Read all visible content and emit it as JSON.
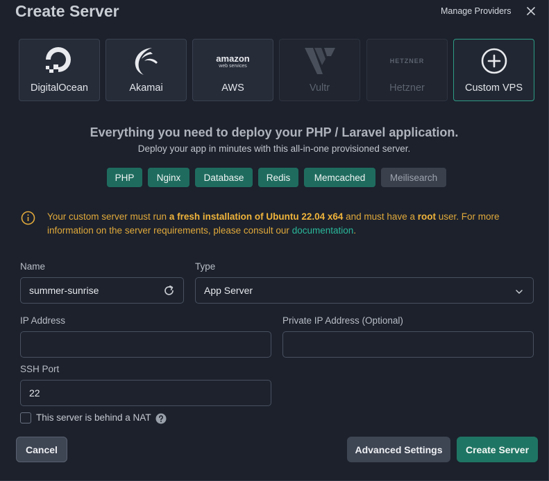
{
  "modal": {
    "title": "Create Server",
    "manage_providers": "Manage Providers",
    "close_icon": "close-icon"
  },
  "providers": [
    {
      "name": "DigitalOcean",
      "icon": "digitalocean-logo",
      "state": "normal"
    },
    {
      "name": "Akamai",
      "icon": "akamai-logo",
      "state": "normal"
    },
    {
      "name": "AWS",
      "icon": "aws-logo",
      "state": "normal",
      "logo_text": "amazon",
      "logo_subtext": "web services"
    },
    {
      "name": "Vultr",
      "icon": "vultr-logo",
      "state": "disabled"
    },
    {
      "name": "Hetzner",
      "icon": "hetzner-logo",
      "state": "disabled",
      "logo_text": "HETZNER"
    },
    {
      "name": "Custom VPS",
      "icon": "plus-circle-icon",
      "state": "selected"
    }
  ],
  "intro": {
    "headline": "Everything you need to deploy your PHP / Laravel application.",
    "subline": "Deploy your app in minutes with this all-in-one provisioned server."
  },
  "tags": [
    {
      "label": "PHP",
      "enabled": true
    },
    {
      "label": "Nginx",
      "enabled": true
    },
    {
      "label": "Database",
      "enabled": true
    },
    {
      "label": "Redis",
      "enabled": true
    },
    {
      "label": "Memcached",
      "enabled": true
    },
    {
      "label": "Meilisearch",
      "enabled": false
    }
  ],
  "notice": {
    "icon": "info-circle-icon",
    "text_1": "Your custom server must run ",
    "bold_1": "a fresh installation of Ubuntu 22.04 x64",
    "text_2": " and must have a ",
    "bold_2": "root",
    "text_3": " user. For more information on the server requirements, please consult our ",
    "link": "documentation",
    "text_4": "."
  },
  "form": {
    "name_label": "Name",
    "name_value": "summer-sunrise",
    "type_label": "Type",
    "type_value": "App Server",
    "ip_label": "IP Address",
    "ip_value": "",
    "private_ip_label": "Private IP Address (Optional)",
    "private_ip_value": "",
    "ssh_label": "SSH Port",
    "ssh_value": "22",
    "nat_label": "This server is behind a NAT"
  },
  "buttons": {
    "cancel": "Cancel",
    "advanced": "Advanced Settings",
    "create": "Create Server"
  },
  "colors": {
    "accent": "#1f7563",
    "tag_bg": "#1f6c5f",
    "warning": "#e1a93b",
    "link": "#2bb89b"
  }
}
